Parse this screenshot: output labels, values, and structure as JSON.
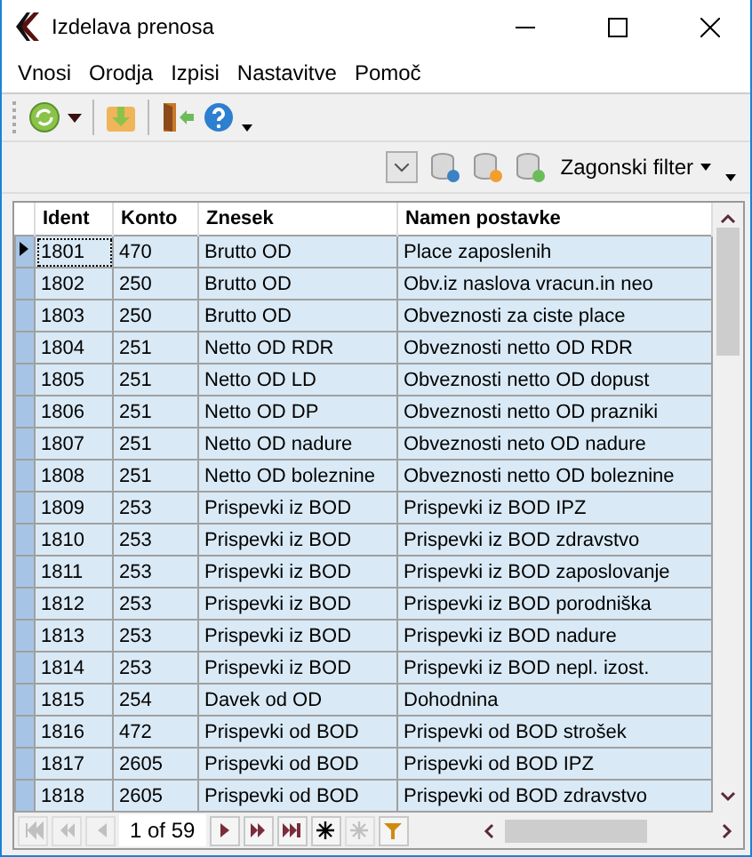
{
  "window": {
    "title": "Izdelava prenosa"
  },
  "menu": [
    "Vnosi",
    "Orodja",
    "Izpisi",
    "Nastavitve",
    "Pomoč"
  ],
  "filter": {
    "label": "Zagonski filter"
  },
  "table": {
    "columns": [
      "Ident",
      "Konto",
      "Znesek",
      "Namen postavke"
    ],
    "rows": [
      {
        "cells": [
          "1801",
          "470",
          "Brutto OD",
          "Place zaposlenih"
        ],
        "selected": true
      },
      {
        "cells": [
          "1802",
          "250",
          "Brutto OD",
          "Obv.iz naslova vracun.in neo"
        ],
        "selected": false
      },
      {
        "cells": [
          "1803",
          "250",
          "Brutto OD",
          "Obveznosti za ciste place"
        ],
        "selected": false
      },
      {
        "cells": [
          "1804",
          "251",
          "Netto OD RDR",
          "Obveznosti netto OD RDR"
        ],
        "selected": false
      },
      {
        "cells": [
          "1805",
          "251",
          "Netto OD LD",
          "Obveznosti netto OD dopust"
        ],
        "selected": false
      },
      {
        "cells": [
          "1806",
          "251",
          "Netto OD DP",
          "Obveznosti netto OD prazniki"
        ],
        "selected": false
      },
      {
        "cells": [
          "1807",
          "251",
          "Netto OD nadure",
          "Obveznosti neto OD nadure"
        ],
        "selected": false
      },
      {
        "cells": [
          "1808",
          "251",
          "Netto OD boleznine",
          "Obveznosti netto OD boleznine"
        ],
        "selected": false
      },
      {
        "cells": [
          "1809",
          "253",
          "Prispevki iz BOD",
          "Prispevki iz BOD IPZ"
        ],
        "selected": false
      },
      {
        "cells": [
          "1810",
          "253",
          "Prispevki iz BOD",
          "Prispevki iz BOD zdravstvo"
        ],
        "selected": false
      },
      {
        "cells": [
          "1811",
          "253",
          "Prispevki iz BOD",
          "Prispevki iz BOD zaposlovanje"
        ],
        "selected": false
      },
      {
        "cells": [
          "1812",
          "253",
          "Prispevki iz BOD",
          "Prispevki iz BOD porodniška"
        ],
        "selected": false
      },
      {
        "cells": [
          "1813",
          "253",
          "Prispevki iz BOD",
          "Prispevki iz BOD nadure"
        ],
        "selected": false
      },
      {
        "cells": [
          "1814",
          "253",
          "Prispevki iz BOD",
          "Prispevki iz BOD nepl. izost."
        ],
        "selected": false
      },
      {
        "cells": [
          "1815",
          "254",
          "Davek od OD",
          "Dohodnina"
        ],
        "selected": false
      },
      {
        "cells": [
          "1816",
          "472",
          "Prispevki od BOD",
          "Prispevki od BOD strošek"
        ],
        "selected": false
      },
      {
        "cells": [
          "1817",
          "2605",
          "Prispevki od BOD",
          "Prispevki od BOD IPZ"
        ],
        "selected": false
      },
      {
        "cells": [
          "1818",
          "2605",
          "Prispevki od BOD",
          "Prispevki od BOD zdravstvo"
        ],
        "selected": false
      }
    ]
  },
  "navigator": {
    "position": "1 of 59",
    "buttons": [
      {
        "kind": "first",
        "disabled": true
      },
      {
        "kind": "prev-page",
        "disabled": true
      },
      {
        "kind": "prev",
        "disabled": true
      },
      {
        "kind": "position"
      },
      {
        "kind": "next",
        "disabled": false
      },
      {
        "kind": "next-page",
        "disabled": false
      },
      {
        "kind": "last",
        "disabled": false
      },
      {
        "kind": "new",
        "disabled": false
      },
      {
        "kind": "delete",
        "disabled": true
      },
      {
        "kind": "filter",
        "disabled": false
      }
    ]
  }
}
